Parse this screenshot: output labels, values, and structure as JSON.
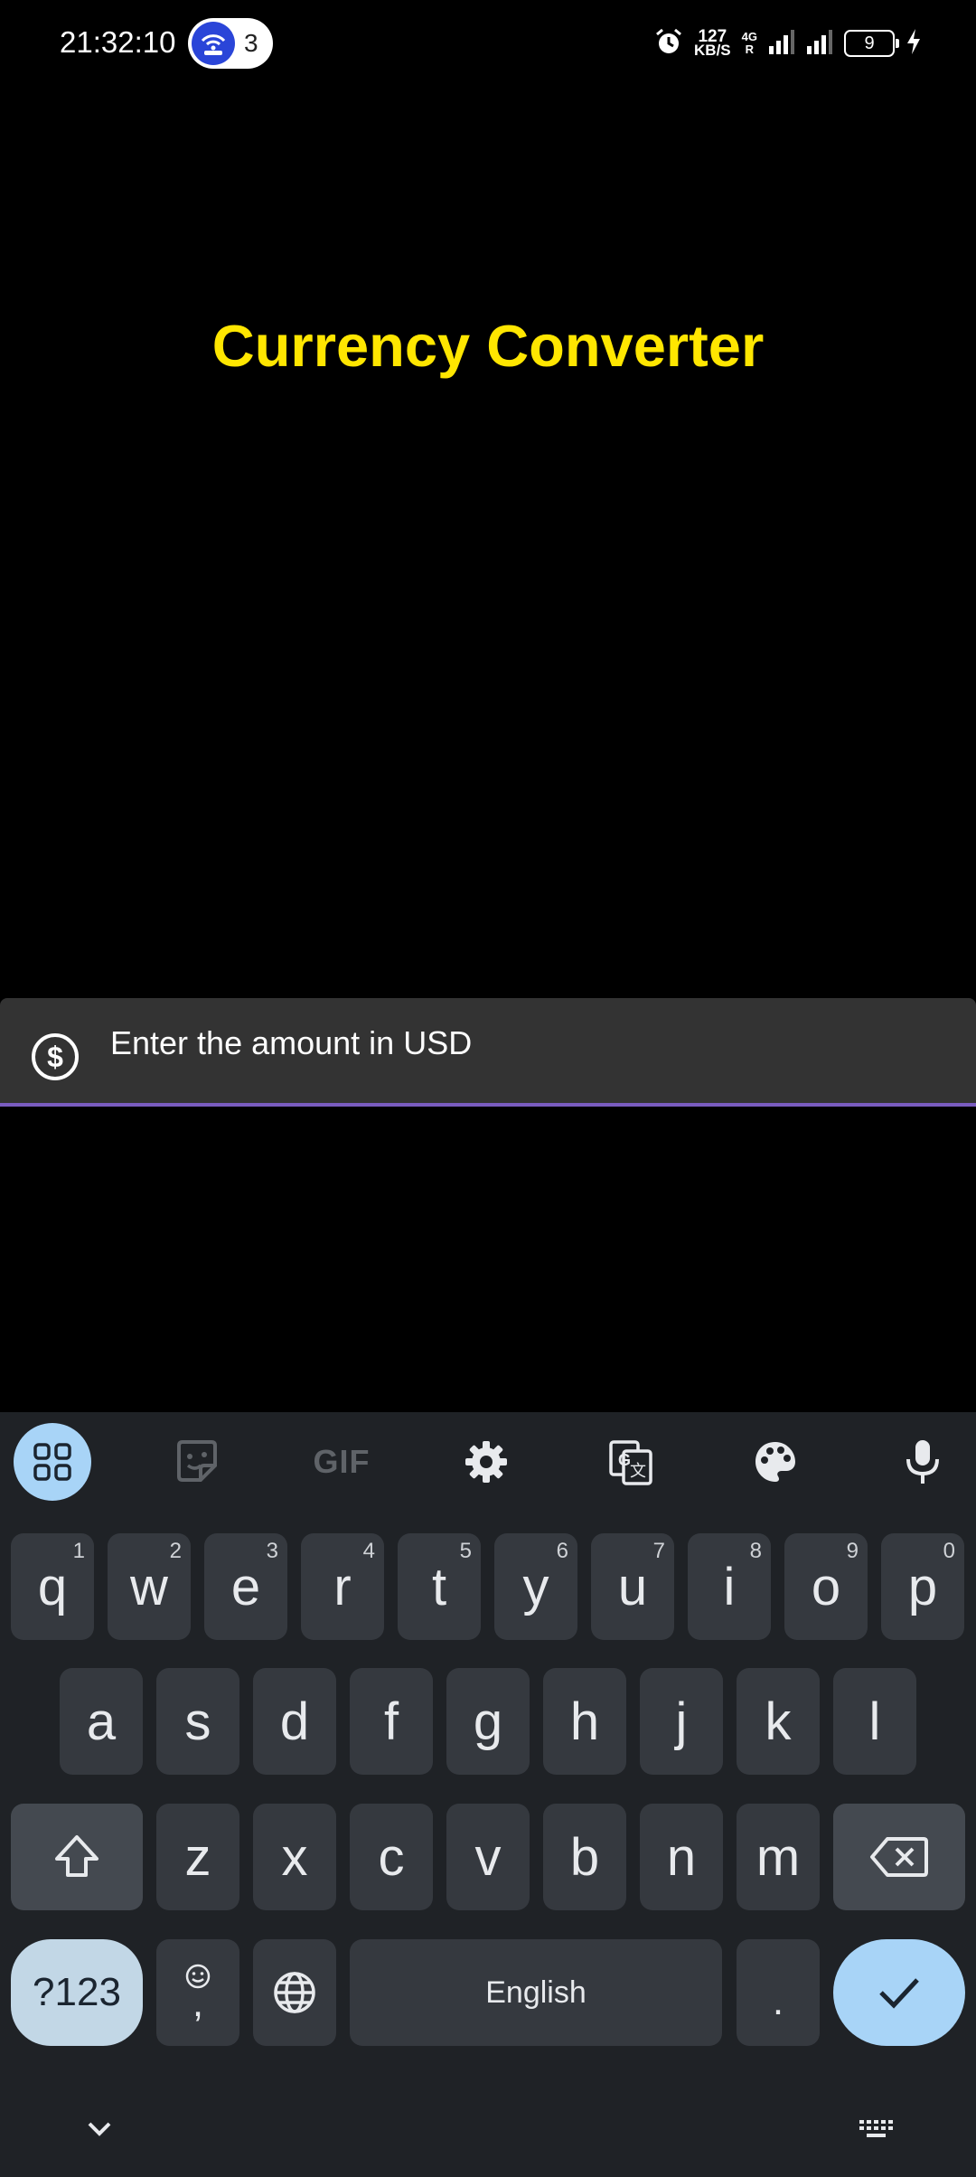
{
  "status_bar": {
    "time": "21:32:10",
    "hotspot_count": "3",
    "net_speed_value": "127",
    "net_speed_unit": "KB/S",
    "network_type": "4G",
    "battery_level": "9"
  },
  "app": {
    "title": "Currency Converter",
    "amount_field": {
      "placeholder": "Enter the amount in USD",
      "value": "",
      "icon": "dollar-circle-icon"
    },
    "accent_color": "#ffe600",
    "underline_color": "#7a5cc0"
  },
  "keyboard": {
    "toolbar_icons": [
      "apps-grid-icon",
      "sticker-icon",
      "gif-icon",
      "settings-icon",
      "translate-icon",
      "palette-icon",
      "mic-icon"
    ],
    "gif_label": "GIF",
    "row1": [
      {
        "key": "q",
        "hint": "1"
      },
      {
        "key": "w",
        "hint": "2"
      },
      {
        "key": "e",
        "hint": "3"
      },
      {
        "key": "r",
        "hint": "4"
      },
      {
        "key": "t",
        "hint": "5"
      },
      {
        "key": "y",
        "hint": "6"
      },
      {
        "key": "u",
        "hint": "7"
      },
      {
        "key": "i",
        "hint": "8"
      },
      {
        "key": "o",
        "hint": "9"
      },
      {
        "key": "p",
        "hint": "0"
      }
    ],
    "row2": [
      "a",
      "s",
      "d",
      "f",
      "g",
      "h",
      "j",
      "k",
      "l"
    ],
    "row3": [
      "z",
      "x",
      "c",
      "v",
      "b",
      "n",
      "m"
    ],
    "symbols_label": "?123",
    "comma_label": ",",
    "space_label": "English",
    "period_label": "."
  }
}
